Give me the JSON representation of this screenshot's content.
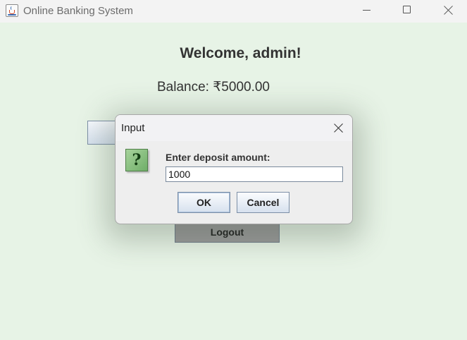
{
  "window": {
    "title": "Online Banking System"
  },
  "main": {
    "welcome": "Welcome, admin!",
    "balance": "Balance: ₹5000.00",
    "logout_label": "Logout"
  },
  "dialog": {
    "title": "Input",
    "prompt": "Enter deposit amount:",
    "input_value": "1000",
    "ok_label": "OK",
    "cancel_label": "Cancel",
    "icon": "question-icon",
    "icon_glyph": "?"
  },
  "colors": {
    "background": "#e7f3e6",
    "titlebar": "#f3f3f3",
    "dialog_background": "#eeeeee",
    "question_icon": "#8fc485"
  }
}
